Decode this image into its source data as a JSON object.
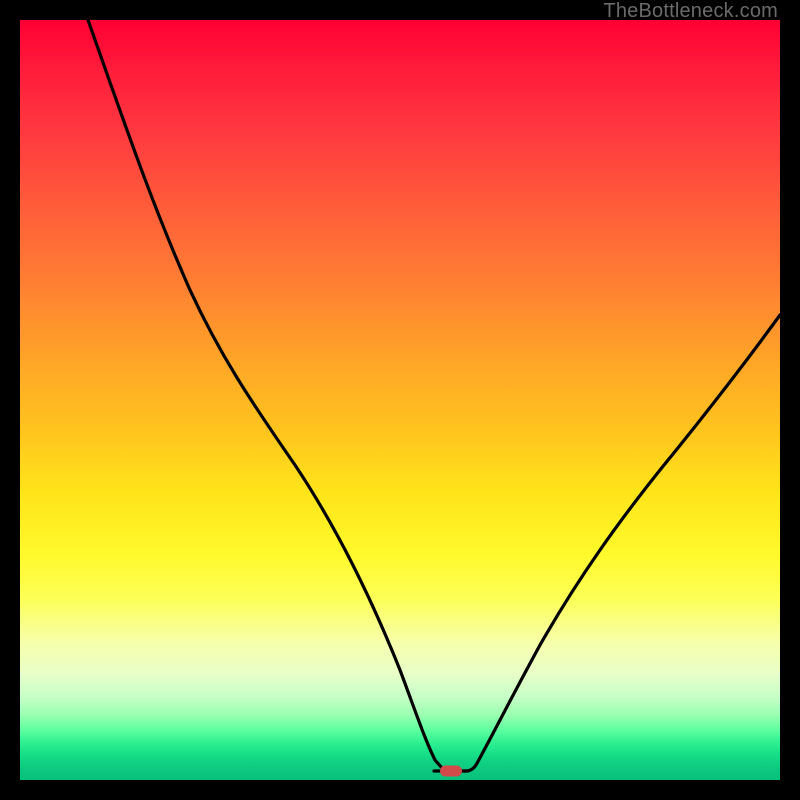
{
  "attribution": "TheBottleneck.com",
  "chart_data": {
    "type": "line",
    "title": "",
    "xlabel": "",
    "ylabel": "",
    "xlim": [
      0,
      100
    ],
    "ylim": [
      0,
      100
    ],
    "x": [
      0,
      10,
      20,
      25,
      30,
      35,
      40,
      45,
      50,
      53,
      55,
      57,
      60,
      65,
      70,
      75,
      80,
      85,
      90,
      95,
      100
    ],
    "values": [
      100,
      88,
      72,
      64,
      55,
      45,
      35,
      24,
      12,
      3,
      0,
      0,
      4,
      14,
      24,
      33,
      41,
      48,
      54,
      59,
      63
    ],
    "marker": {
      "x": 56,
      "y": 0,
      "color": "#d24a4a",
      "shape": "pill"
    },
    "series_color": "#000000",
    "legend": false,
    "grid": false
  }
}
